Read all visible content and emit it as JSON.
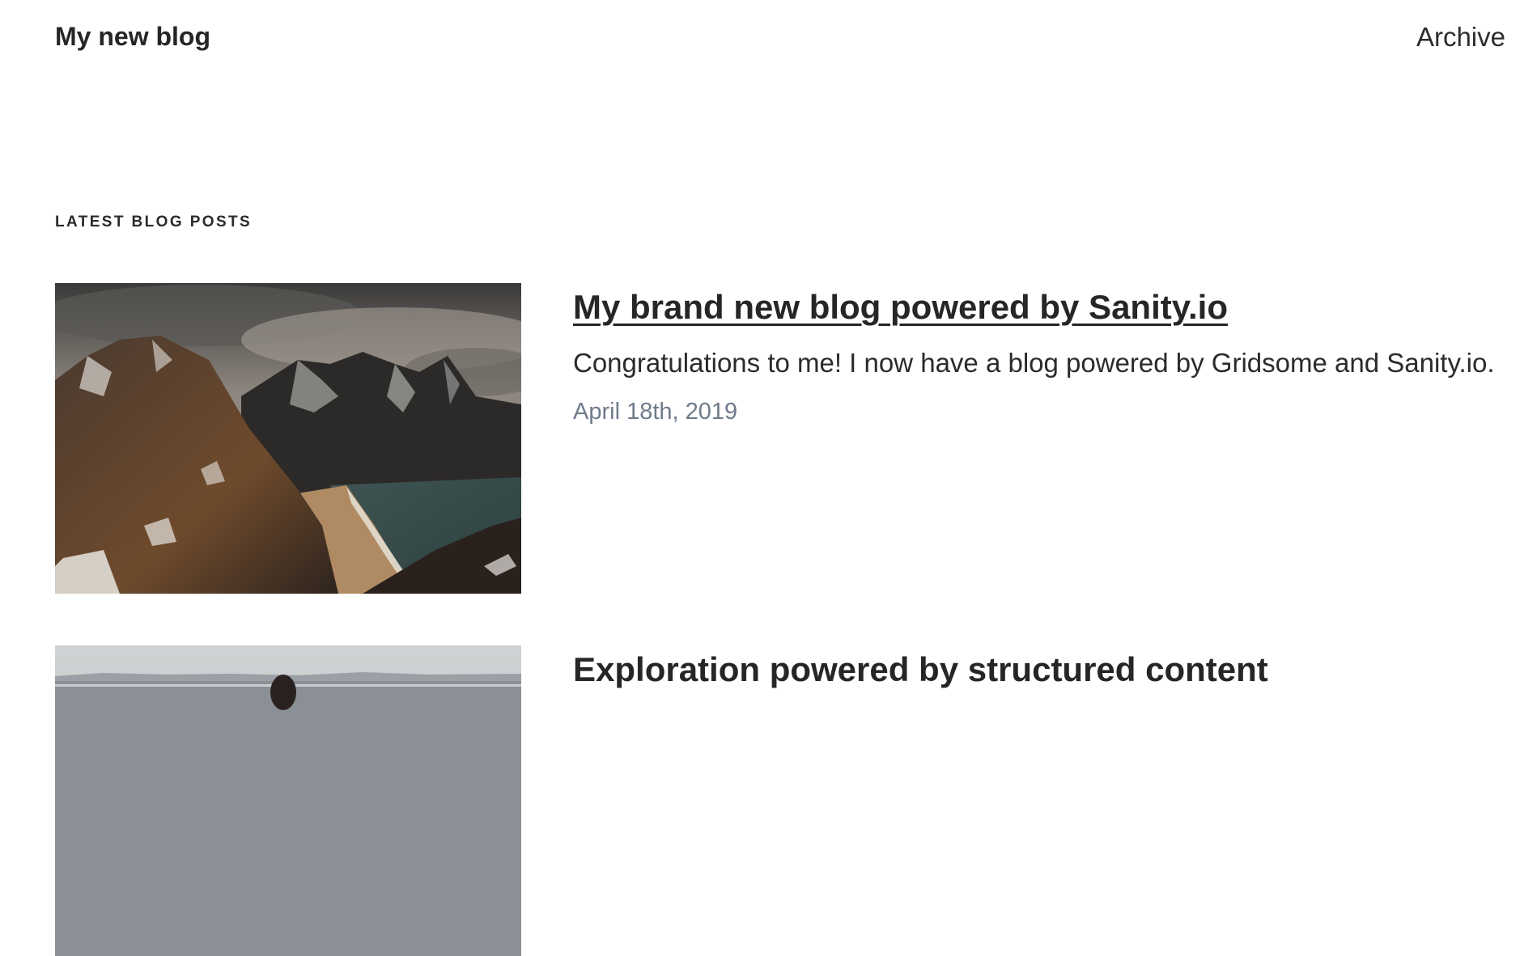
{
  "site": {
    "title": "My new blog",
    "nav": [
      {
        "label": "Archive"
      }
    ]
  },
  "section": {
    "heading": "LATEST BLOG POSTS"
  },
  "posts": [
    {
      "title": "My brand new blog powered by Sanity.io",
      "excerpt": "Congratulations to me! I now have a blog powered by Gridsome and Sanity.io.",
      "date": "April 18th, 2019",
      "image": "mountain-coast-photo"
    },
    {
      "title": "Exploration powered by structured content",
      "image": "person-on-beach-photo"
    }
  ],
  "colors": {
    "text": "#262626",
    "date": "#6f7b8c",
    "background": "#ffffff"
  }
}
